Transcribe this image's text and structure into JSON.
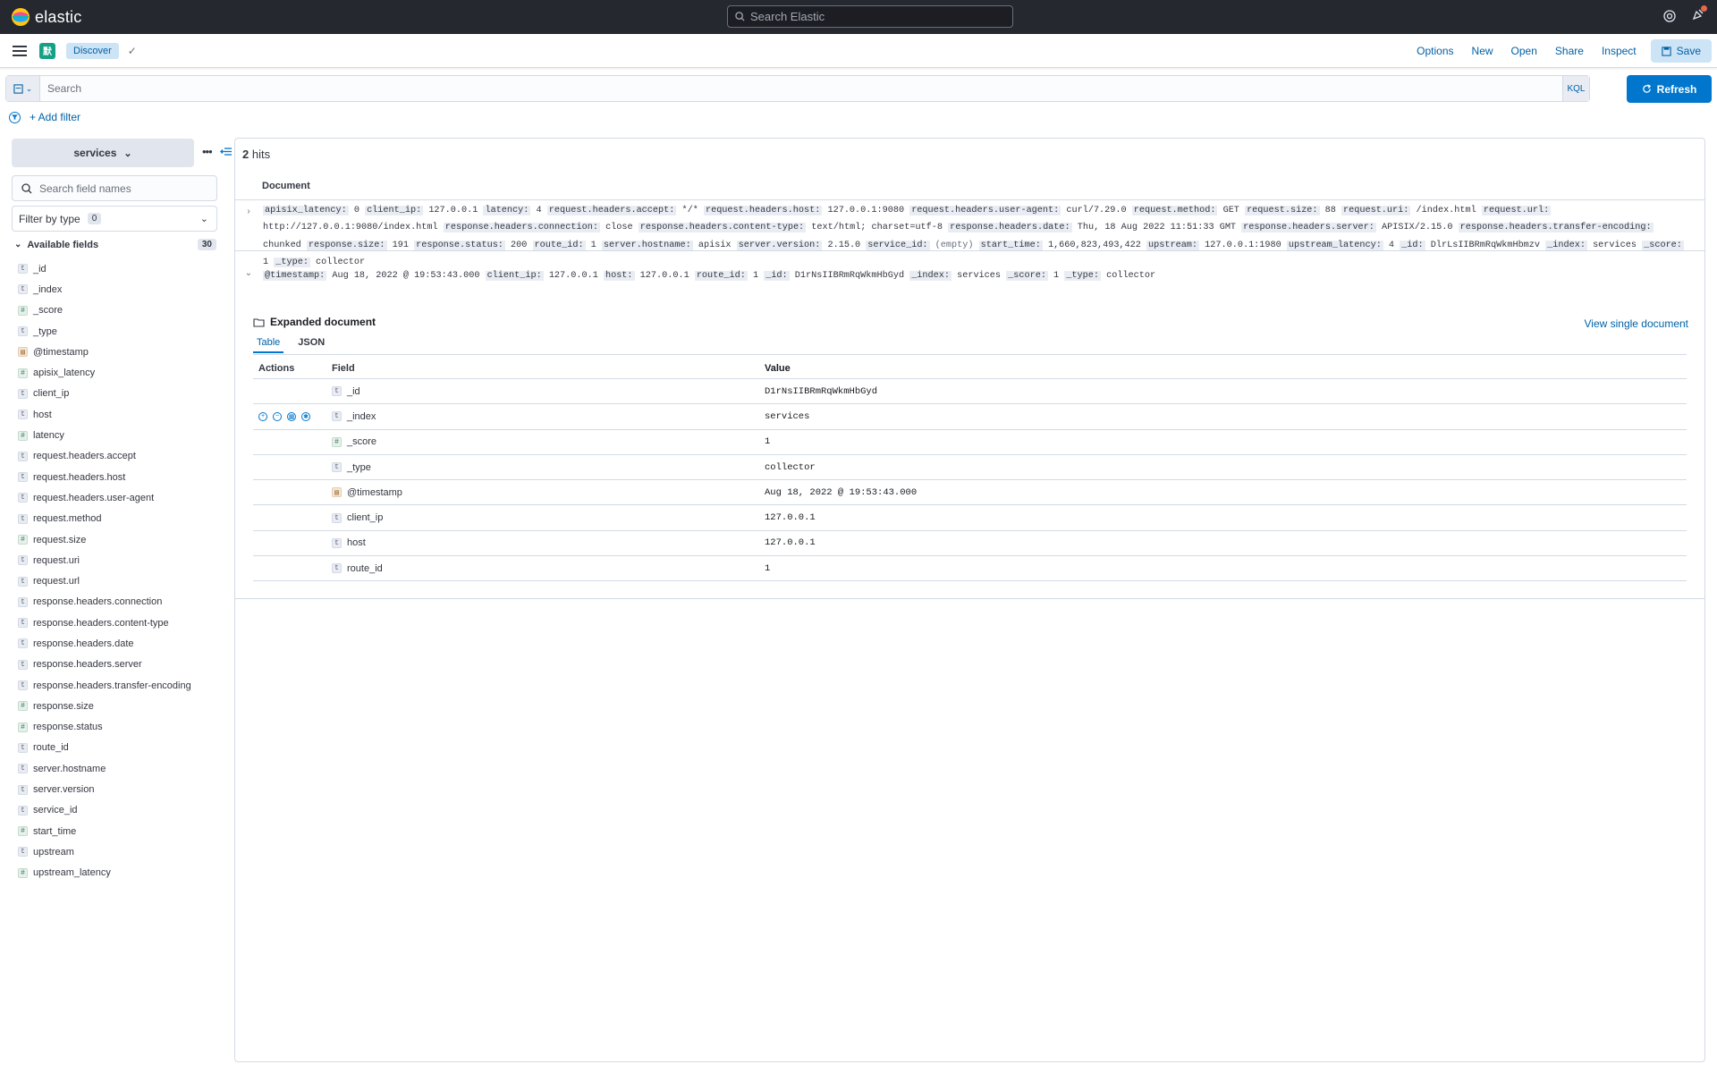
{
  "header": {
    "brand": "elastic",
    "search_placeholder": "Search Elastic"
  },
  "appbar": {
    "space_initial": "默",
    "breadcrumb": "Discover",
    "menu": {
      "options": "Options",
      "new": "New",
      "open": "Open",
      "share": "Share",
      "inspect": "Inspect",
      "save": "Save"
    }
  },
  "query": {
    "placeholder": "Search",
    "language": "KQL",
    "refresh_label": "Refresh",
    "add_filter": "+ Add filter"
  },
  "sidebar": {
    "index_pattern": "services",
    "field_search_placeholder": "Search field names",
    "filter_by_type": "Filter by type",
    "filter_count": "0",
    "available_fields_label": "Available fields",
    "available_fields_count": "30",
    "fields": [
      {
        "name": "_id",
        "type": "string"
      },
      {
        "name": "_index",
        "type": "string"
      },
      {
        "name": "_score",
        "type": "number"
      },
      {
        "name": "_type",
        "type": "string"
      },
      {
        "name": "@timestamp",
        "type": "date"
      },
      {
        "name": "apisix_latency",
        "type": "number"
      },
      {
        "name": "client_ip",
        "type": "string"
      },
      {
        "name": "host",
        "type": "string"
      },
      {
        "name": "latency",
        "type": "number"
      },
      {
        "name": "request.headers.accept",
        "type": "string"
      },
      {
        "name": "request.headers.host",
        "type": "string"
      },
      {
        "name": "request.headers.user-agent",
        "type": "string"
      },
      {
        "name": "request.method",
        "type": "string"
      },
      {
        "name": "request.size",
        "type": "number"
      },
      {
        "name": "request.uri",
        "type": "string"
      },
      {
        "name": "request.url",
        "type": "string"
      },
      {
        "name": "response.headers.connection",
        "type": "string"
      },
      {
        "name": "response.headers.content-type",
        "type": "string"
      },
      {
        "name": "response.headers.date",
        "type": "string"
      },
      {
        "name": "response.headers.server",
        "type": "string"
      },
      {
        "name": "response.headers.transfer-encoding",
        "type": "string"
      },
      {
        "name": "response.size",
        "type": "number"
      },
      {
        "name": "response.status",
        "type": "number"
      },
      {
        "name": "route_id",
        "type": "string"
      },
      {
        "name": "server.hostname",
        "type": "string"
      },
      {
        "name": "server.version",
        "type": "string"
      },
      {
        "name": "service_id",
        "type": "string"
      },
      {
        "name": "start_time",
        "type": "number"
      },
      {
        "name": "upstream",
        "type": "string"
      },
      {
        "name": "upstream_latency",
        "type": "number"
      }
    ]
  },
  "results": {
    "hits_count": "2",
    "hits_label": "hits",
    "document_header": "Document",
    "row1": [
      [
        "apisix_latency:",
        "0"
      ],
      [
        "client_ip:",
        "127.0.0.1"
      ],
      [
        "latency:",
        "4"
      ],
      [
        "request.headers.accept:",
        "*/*"
      ],
      [
        "request.headers.host:",
        "127.0.0.1:9080"
      ],
      [
        "request.headers.user-agent:",
        "curl/7.29.0"
      ],
      [
        "request.method:",
        "GET"
      ],
      [
        "request.size:",
        "88"
      ],
      [
        "request.uri:",
        "/index.html"
      ],
      [
        "request.url:",
        "http://127.0.0.1:9080/index.html"
      ],
      [
        "response.headers.connection:",
        "close"
      ],
      [
        "response.headers.content-type:",
        "text/html; charset=utf-8"
      ],
      [
        "response.headers.date:",
        "Thu, 18 Aug 2022 11:51:33 GMT"
      ],
      [
        "response.headers.server:",
        "APISIX/2.15.0"
      ],
      [
        "response.headers.transfer-encoding:",
        "chunked"
      ],
      [
        "response.size:",
        "191"
      ],
      [
        "response.status:",
        "200"
      ],
      [
        "route_id:",
        "1"
      ],
      [
        "server.hostname:",
        "apisix"
      ],
      [
        "server.version:",
        "2.15.0"
      ],
      [
        "service_id:",
        "(empty)"
      ],
      [
        "start_time:",
        "1,660,823,493,422"
      ],
      [
        "upstream:",
        "127.0.0.1:1980"
      ],
      [
        "upstream_latency:",
        "4"
      ],
      [
        "_id:",
        "DlrLsIIBRmRqWkmHbmzv"
      ],
      [
        "_index:",
        "services"
      ],
      [
        "_score:",
        "1"
      ],
      [
        "_type:",
        "collector"
      ]
    ],
    "row2": [
      [
        "@timestamp:",
        "Aug 18, 2022 @ 19:53:43.000"
      ],
      [
        "client_ip:",
        "127.0.0.1"
      ],
      [
        "host:",
        "127.0.0.1"
      ],
      [
        "route_id:",
        "1"
      ],
      [
        "_id:",
        "D1rNsIIBRmRqWkmHbGyd"
      ],
      [
        "_index:",
        "services"
      ],
      [
        "_score:",
        "1"
      ],
      [
        "_type:",
        "collector"
      ]
    ],
    "expanded": {
      "title": "Expanded document",
      "view_single": "View single document",
      "tab_table": "Table",
      "tab_json": "JSON",
      "col_actions": "Actions",
      "col_field": "Field",
      "col_value": "Value",
      "rows": [
        {
          "field": "_id",
          "type": "string",
          "value": "D1rNsIIBRmRqWkmHbGyd"
        },
        {
          "field": "_index",
          "type": "string",
          "value": "services"
        },
        {
          "field": "_score",
          "type": "number",
          "value": "1"
        },
        {
          "field": "_type",
          "type": "string",
          "value": "collector"
        },
        {
          "field": "@timestamp",
          "type": "date",
          "value": "Aug 18, 2022 @ 19:53:43.000"
        },
        {
          "field": "client_ip",
          "type": "string",
          "value": "127.0.0.1"
        },
        {
          "field": "host",
          "type": "string",
          "value": "127.0.0.1"
        },
        {
          "field": "route_id",
          "type": "string",
          "value": "1"
        }
      ]
    }
  }
}
